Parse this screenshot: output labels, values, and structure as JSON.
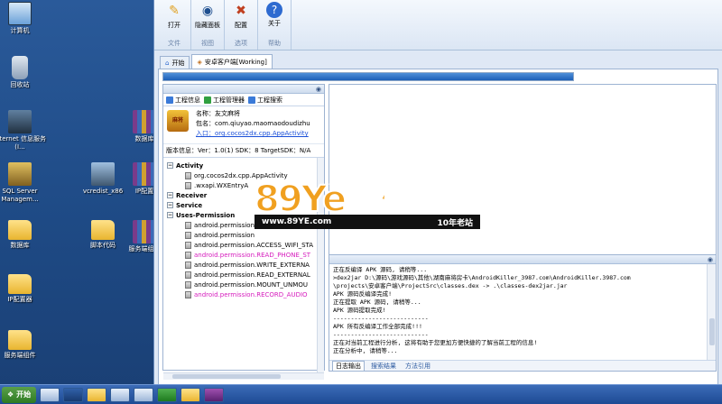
{
  "desktop": {
    "icons": [
      {
        "label": "计算机"
      },
      {
        "label": "回收站"
      },
      {
        "label": "Internet 信息服务(I..."
      },
      {
        "label": "数据库"
      },
      {
        "label": "SQL Server Managem..."
      },
      {
        "label": "vcredist_x86"
      },
      {
        "label": "IP配置"
      },
      {
        "label": "数据库"
      },
      {
        "label": "服务端组件"
      },
      {
        "label": "脚本代码"
      },
      {
        "label": "服务端组件"
      },
      {
        "label": "IP配置器"
      },
      {
        "label": "服务端组件"
      }
    ]
  },
  "ribbon": {
    "groups": [
      {
        "name": "文件",
        "buttons": [
          {
            "label": "打开",
            "icon": "folder-open-icon"
          }
        ]
      },
      {
        "name": "视图",
        "buttons": [
          {
            "label": "隐藏面板",
            "icon": "eye-icon"
          }
        ]
      },
      {
        "name": "选项",
        "buttons": [
          {
            "label": "配置",
            "icon": "tools-icon"
          }
        ]
      },
      {
        "name": "帮助",
        "buttons": [
          {
            "label": "关于",
            "icon": "help-icon"
          }
        ]
      }
    ]
  },
  "tabs": [
    {
      "label": "开始",
      "active": false
    },
    {
      "label": "安卓客户端[Working]",
      "active": true
    }
  ],
  "progress": {
    "percent": 100
  },
  "leftpane": {
    "subtabs": [
      "工程信息",
      "工程管理器",
      "工程搜索"
    ],
    "app": {
      "logo_text": "麻将",
      "name": "名称：友文麻将",
      "package": "包名：com.qiuyao.maomaodoudizhu",
      "entry": "入口：org.cocos2dx.cpp.AppActivity",
      "version": "版本信息：Ver：1.0(1) SDK：8 TargetSDK：N/A"
    },
    "tree": [
      {
        "text": "Activity",
        "bold": true,
        "level": 0
      },
      {
        "text": "org.cocos2dx.cpp.AppActivity",
        "level": 1
      },
      {
        "text": ".wxapi.WXEntryA",
        "level": 1
      },
      {
        "text": "Receiver",
        "bold": true,
        "level": 0
      },
      {
        "text": "Service",
        "bold": true,
        "level": 0
      },
      {
        "text": "Uses-Permission",
        "bold": true,
        "level": 0
      },
      {
        "text": "android.permission",
        "level": 1
      },
      {
        "text": "android.permission",
        "level": 1
      },
      {
        "text": "android.permission.ACCESS_WIFI_STA",
        "level": 1
      },
      {
        "text": "android.permission.READ_PHONE_ST",
        "level": 1,
        "magenta": true
      },
      {
        "text": "android.permission.WRITE_EXTERNA",
        "level": 1
      },
      {
        "text": "android.permission.READ_EXTERNAL",
        "level": 1
      },
      {
        "text": "android.permission.MOUNT_UNMOU",
        "level": 1
      },
      {
        "text": "android.permission.RECORD_AUDIO",
        "level": 1,
        "magenta": true
      }
    ]
  },
  "log": {
    "lines": [
      "正在反编译 APK 源码, 请稍等...",
      ">dex2jar D:\\源码\\游戏源码\\其他\\湖南麻将房卡\\AndroidKiller_3987.com\\AndroidKiller.3987.com",
      "\\projects\\安卓客户端\\ProjectSrc\\classes.dex -> .\\classes-dex2jar.jar",
      "APK 源码反编译完成!",
      "正在提取 APK 源码, 请稍等...",
      "APK 源码提取完成!",
      "---------------------------",
      "APK 所有反编译工作全部完成!!!",
      "---------------------------",
      "正在对当前工程进行分析, 这将有助于您更加方便快捷的了解当前工程的信息!",
      "正在分析中, 请稍等..."
    ],
    "tabs": [
      {
        "label": "日志输出",
        "active": true
      },
      {
        "label": "搜索结果",
        "active": false
      },
      {
        "label": "方法引用",
        "active": false
      }
    ]
  },
  "watermark": {
    "big": "89Ye源码",
    "url": "www.89YE.com",
    "slogan": "10年老站"
  },
  "taskbar": {
    "start_label": "开始"
  }
}
